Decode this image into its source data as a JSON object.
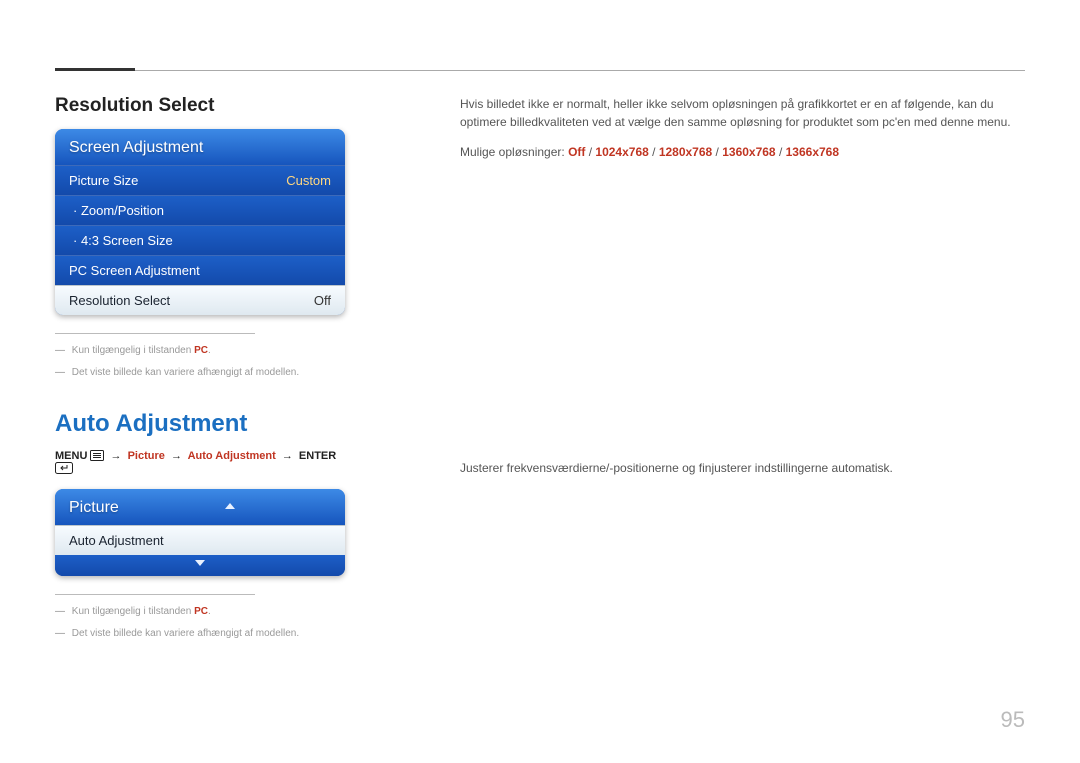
{
  "page_number": "95",
  "section1": {
    "title": "Resolution Select",
    "menu_header": "Screen Adjustment",
    "rows": {
      "picture_size": {
        "label": "Picture Size",
        "value": "Custom"
      },
      "zoom_position": {
        "label": "· Zoom/Position"
      },
      "screen43": {
        "label": "· 4:3 Screen Size"
      },
      "pc_adjust": {
        "label": "PC Screen Adjustment"
      },
      "res_select": {
        "label": "Resolution Select",
        "value": "Off"
      }
    },
    "footnotes": {
      "pc_only_prefix": "Kun tilgængelig i tilstanden ",
      "pc_only_suffix": "PC",
      "pc_only_period": ".",
      "vary": "Det viste billede kan variere afhængigt af modellen."
    },
    "right": {
      "para": "Hvis billedet ikke er normalt, heller ikke selvom opløsningen på grafikkortet er en af følgende, kan du optimere billedkvaliteten ved at vælge den samme opløsning for produktet som pc'en med denne menu.",
      "options_label": "Mulige opløsninger: ",
      "opt_off": "Off",
      "sep": " / ",
      "opt1": "1024x768",
      "opt2": "1280x768",
      "opt3": "1360x768",
      "opt4": "1366x768"
    }
  },
  "section2": {
    "title": "Auto Adjustment",
    "nav": {
      "menu": "MENU",
      "picture": "Picture",
      "auto": "Auto Adjustment",
      "enter": "ENTER"
    },
    "menu_header": "Picture",
    "row_auto": "Auto Adjustment",
    "footnotes": {
      "pc_only_prefix": "Kun tilgængelig i tilstanden ",
      "pc_only_suffix": "PC",
      "pc_only_period": ".",
      "vary": "Det viste billede kan variere afhængigt af modellen."
    },
    "right": {
      "para": "Justerer frekvensværdierne/-positionerne og finjusterer indstillingerne automatisk."
    }
  }
}
